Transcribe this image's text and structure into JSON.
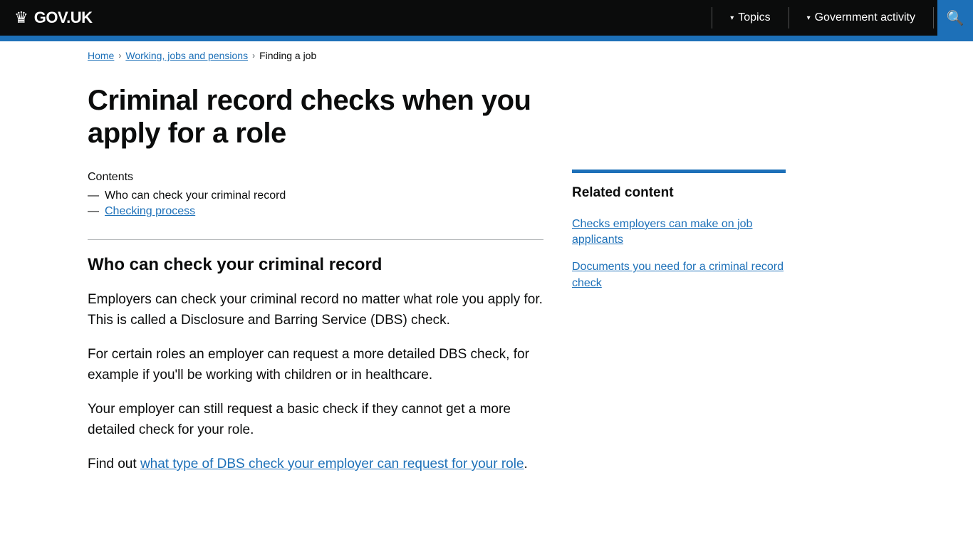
{
  "header": {
    "logo_text": "GOV.UK",
    "topics_label": "Topics",
    "gov_activity_label": "Government activity",
    "search_label": "Search"
  },
  "breadcrumb": {
    "items": [
      {
        "label": "Home",
        "href": true
      },
      {
        "label": "Working, jobs and pensions",
        "href": true
      },
      {
        "label": "Finding a job",
        "href": true
      }
    ]
  },
  "page": {
    "title": "Criminal record checks when you apply for a role",
    "contents_label": "Contents",
    "contents_items": [
      {
        "text": "Who can check your criminal record",
        "link": false
      },
      {
        "text": "Checking process",
        "link": true
      }
    ],
    "section_heading": "Who can check your criminal record",
    "paragraphs": [
      {
        "text": "Employers can check your criminal record no matter what role you apply for. This is called a Disclosure and Barring Service (DBS) check.",
        "link": null
      },
      {
        "text": "For certain roles an employer can request a more detailed DBS check, for example if you'll be working with children or in healthcare.",
        "link": null
      },
      {
        "text": "Your employer can still request a basic check if they cannot get a more detailed check for your role.",
        "link": null
      },
      {
        "text_before": "Find out ",
        "link_text": "what type of DBS check your employer can request for your role",
        "text_after": "."
      }
    ]
  },
  "sidebar": {
    "related_title": "Related content",
    "related_links": [
      {
        "text": "Checks employers can make on job applicants"
      },
      {
        "text": "Documents you need for a criminal record check"
      }
    ]
  }
}
